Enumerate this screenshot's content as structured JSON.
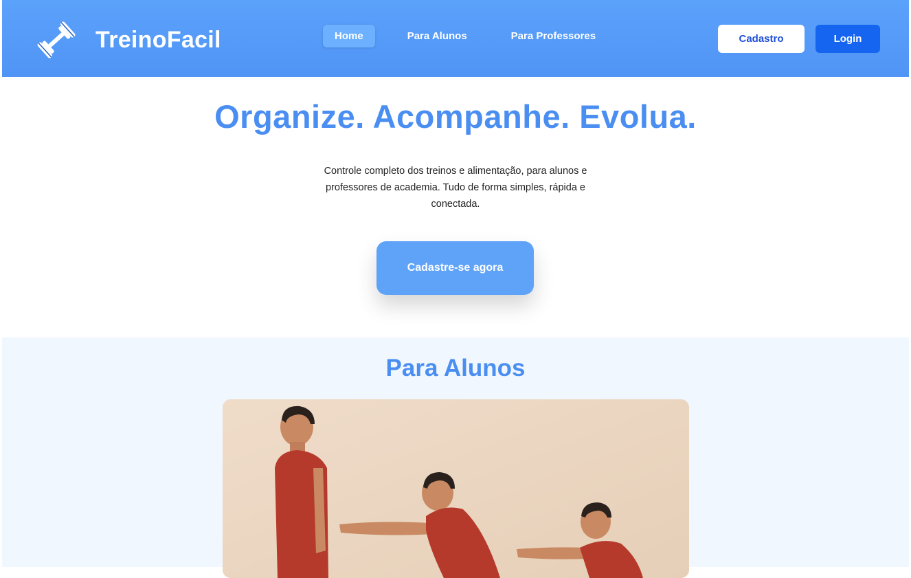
{
  "header": {
    "brand_name": "TreinoFacil",
    "brand_icon": "dumbbell-icon",
    "nav": [
      {
        "label": "Home",
        "active": true
      },
      {
        "label": "Para Alunos",
        "active": false
      },
      {
        "label": "Para Professores",
        "active": false
      }
    ],
    "signup_label": "Cadastro",
    "login_label": "Login"
  },
  "hero": {
    "title": "Organize. Acompanhe. Evolua.",
    "subtitle": "Controle completo dos treinos e alimentação, para alunos e professores de academia. Tudo de forma simples, rápida e conectada.",
    "cta_label": "Cadastre-se agora"
  },
  "students_section": {
    "title": "Para Alunos",
    "image": "squat-sequence-photo"
  },
  "colors": {
    "navbar": "#5094f5",
    "accent": "#4a8ef2",
    "login_button": "#1565f0",
    "cta": "#5fa3f8",
    "section_bg": "#f1f7fe"
  }
}
